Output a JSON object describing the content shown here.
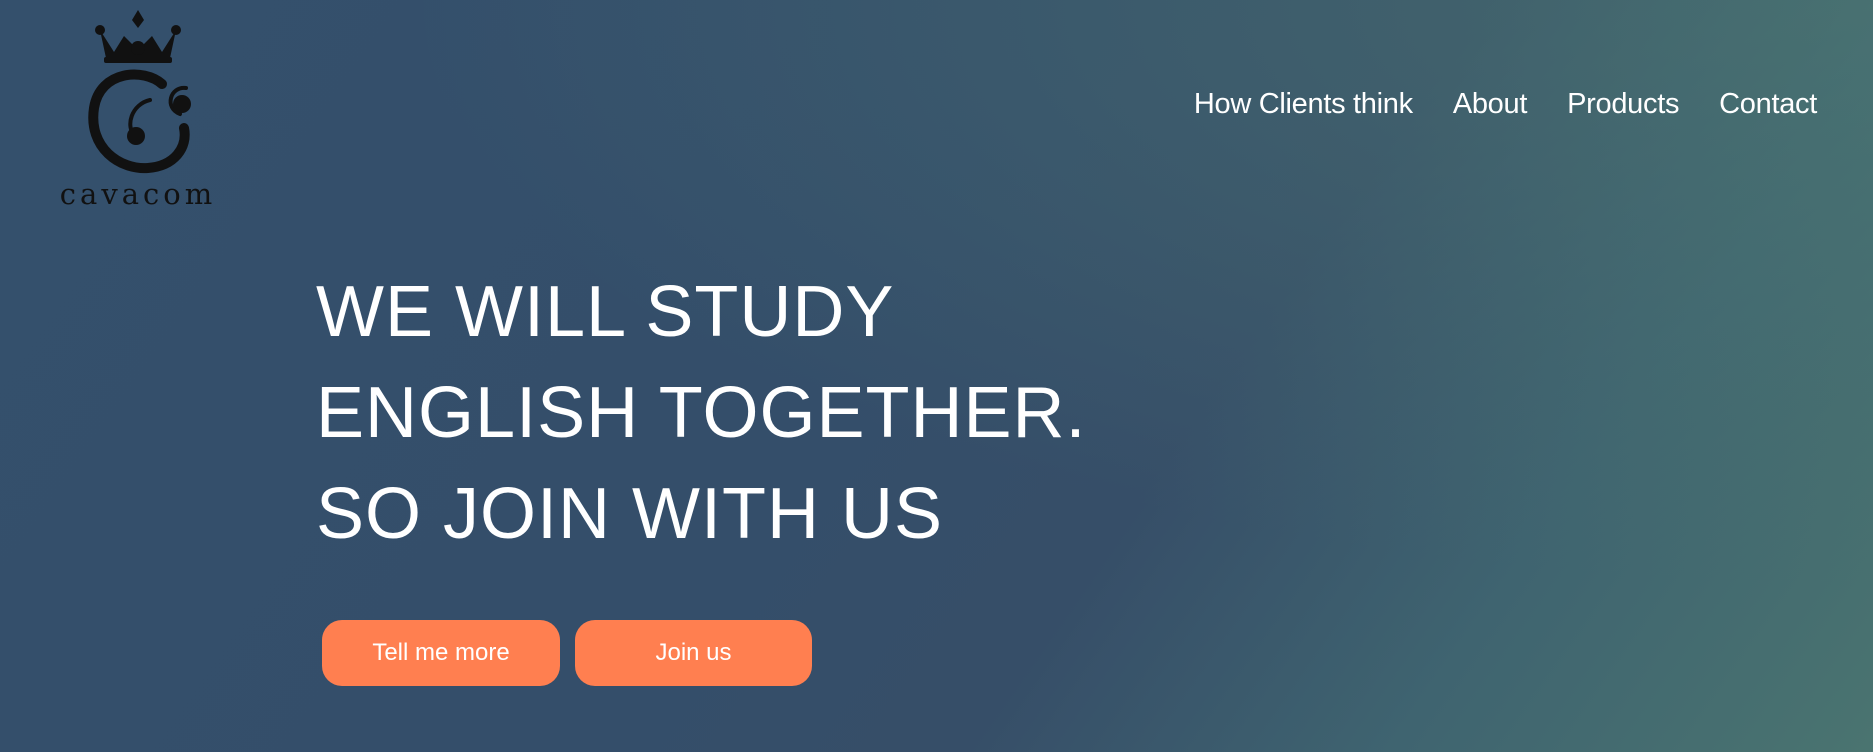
{
  "brand": {
    "name": "cavacom",
    "logo_icon": "crown-c-monogram"
  },
  "nav": {
    "items": [
      {
        "label": "How Clients think"
      },
      {
        "label": "About"
      },
      {
        "label": "Products"
      },
      {
        "label": "Contact"
      }
    ]
  },
  "hero": {
    "lines": [
      "WE WILL STUDY",
      "ENGLISH TOGETHER.",
      "SO JOIN WITH US"
    ]
  },
  "buttons": {
    "tell_more_label": "Tell me more",
    "join_label": "Join us"
  },
  "colors": {
    "accent": "#ff7f50",
    "background": "#354f6b",
    "background_highlight": "#4a7470",
    "logo": "#111111",
    "text": "#ffffff"
  }
}
